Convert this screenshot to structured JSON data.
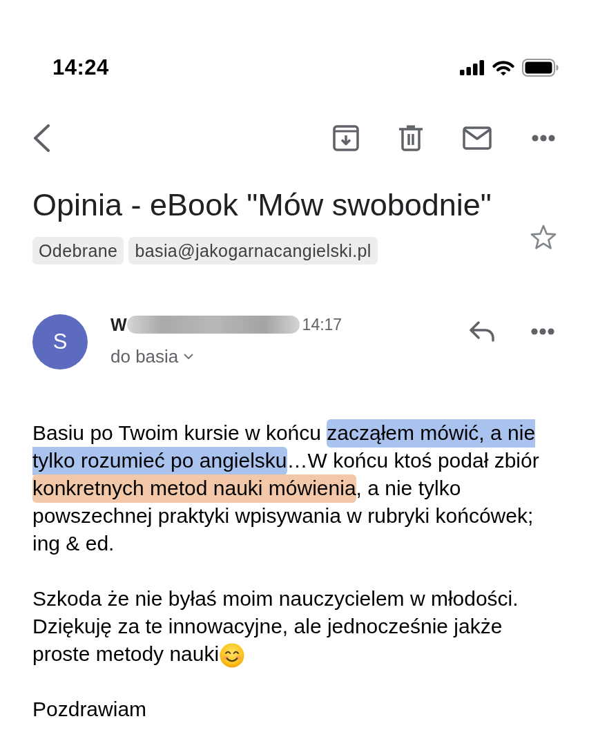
{
  "status_bar": {
    "time": "14:24"
  },
  "email": {
    "subject": "Opinia - eBook \"Mów swobodnie\"",
    "starred": false,
    "labels": [
      "Odebrane",
      "basia@jakogarnacangielski.pl"
    ]
  },
  "message": {
    "sender": {
      "initial": "S",
      "name": "W",
      "redacted": true,
      "time": "14:17",
      "recipients": "do basia"
    },
    "body": [
      {
        "segments": [
          {
            "text": "Basiu po Twoim kursie w końcu "
          },
          {
            "text": "zacząłem mówić, a nie tylko rozumieć po angielsku",
            "color": "#aac3ee"
          },
          {
            "text": "…W końcu ktoś podał zbiór "
          },
          {
            "text": "konkretnych metod nauki mówienia",
            "color": "#f3c8a9"
          },
          {
            "text": ", a nie tylko powszechnej praktyki wpisywania w rubryki końcówek; ing & ed."
          }
        ],
        "emoji": false
      },
      {
        "segments": [
          {
            "text": "Szkoda że nie byłaś moim nauczycielem w młodości. Dziękuję za te innowacyjne, ale jednocześnie jakże proste metody nauki"
          }
        ],
        "emoji": true
      },
      {
        "segments": [
          {
            "text": "Pozdrawiam"
          }
        ],
        "emoji": false
      }
    ]
  }
}
